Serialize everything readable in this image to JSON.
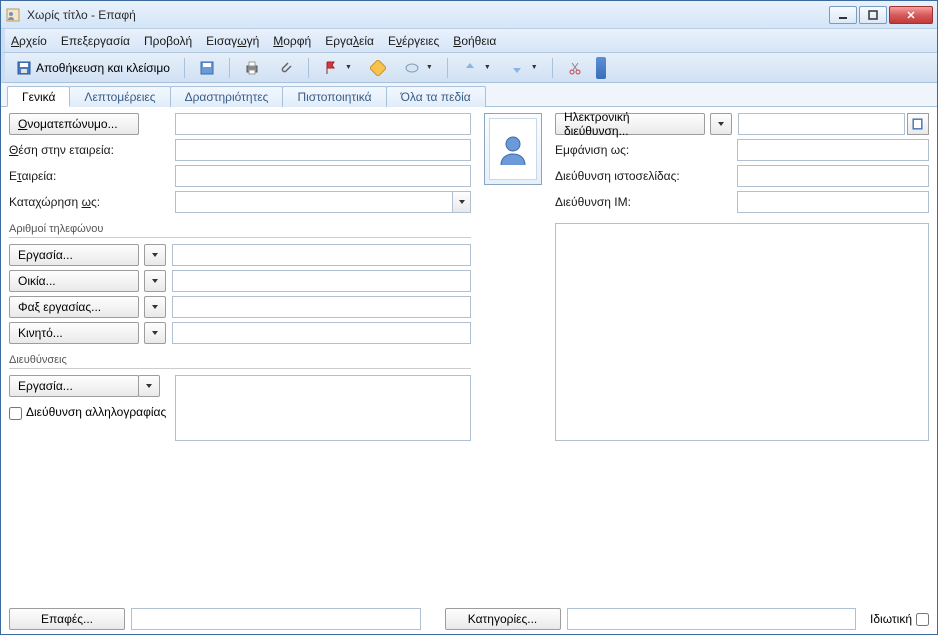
{
  "window": {
    "title": "Χωρίς τίτλο - Επαφή"
  },
  "menu": {
    "file": "Αρχείο",
    "edit": "Επεξεργασία",
    "view": "Προβολή",
    "insert": "Εισαγωγή",
    "format": "Μορφή",
    "tools": "Εργαλεία",
    "actions": "Ενέργειες",
    "help": "Βοήθεια"
  },
  "toolbar": {
    "save_close": "Αποθήκευση και κλείσιμο"
  },
  "tabs": {
    "general": "Γενικά",
    "details": "Λεπτομέρειες",
    "activities": "Δραστηριότητες",
    "certs": "Πιστοποιητικά",
    "allfields": "Όλα τα πεδία"
  },
  "fields": {
    "fullname_btn": "Ονοματεπώνυμο...",
    "fullname_val": "",
    "position_lbl": "Θέση στην εταιρεία:",
    "position_val": "",
    "company_lbl": "Εταιρεία:",
    "company_val": "",
    "fileas_lbl": "Καταχώρηση ως:",
    "fileas_val": "",
    "phones_group": "Αριθμοί τηλεφώνου",
    "phone_work": "Εργασία...",
    "phone_work_val": "",
    "phone_home": "Οικία...",
    "phone_home_val": "",
    "phone_fax": "Φαξ εργασίας...",
    "phone_fax_val": "",
    "phone_mobile": "Κινητό...",
    "phone_mobile_val": "",
    "addr_group": "Διευθύνσεις",
    "addr_type": "Εργασία...",
    "addr_val": "",
    "mailcorr_chk": "Διεύθυνση αλληλογραφίας",
    "email_btn": "Ηλεκτρονική διεύθυνση...",
    "email_val": "",
    "displayas_lbl": "Εμφάνιση ως:",
    "displayas_val": "",
    "web_lbl": "Διεύθυνση ιστοσελίδας:",
    "web_val": "",
    "im_lbl": "Διεύθυνση IM:",
    "im_val": "",
    "notes_val": ""
  },
  "footer": {
    "contacts_btn": "Επαφές...",
    "contacts_val": "",
    "categories_btn": "Κατηγορίες...",
    "categories_val": "",
    "private_lbl": "Ιδιωτική"
  }
}
